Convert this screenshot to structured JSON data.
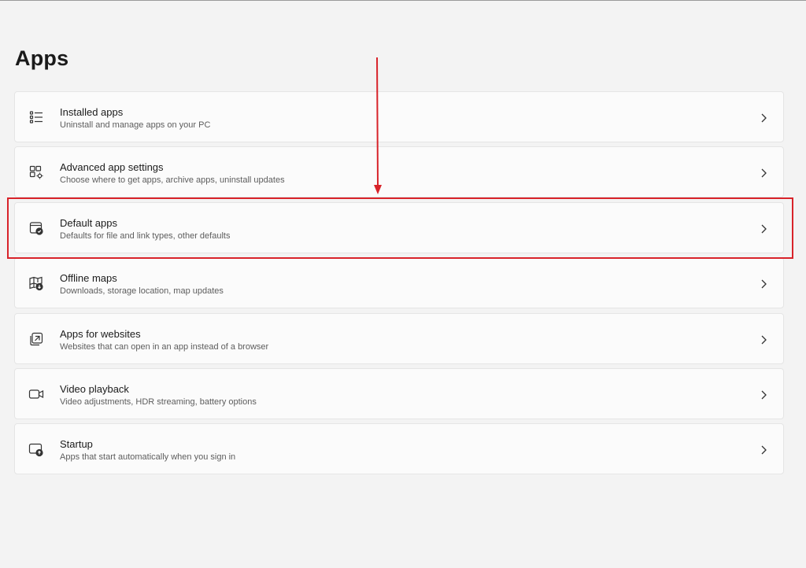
{
  "page": {
    "title": "Apps"
  },
  "items": [
    {
      "icon": "list-icon",
      "title": "Installed apps",
      "subtitle": "Uninstall and manage apps on your PC"
    },
    {
      "icon": "app-settings-icon",
      "title": "Advanced app settings",
      "subtitle": "Choose where to get apps, archive apps, uninstall updates"
    },
    {
      "icon": "default-apps-icon",
      "title": "Default apps",
      "subtitle": "Defaults for file and link types, other defaults"
    },
    {
      "icon": "offline-map-icon",
      "title": "Offline maps",
      "subtitle": "Downloads, storage location, map updates"
    },
    {
      "icon": "open-in-app-icon",
      "title": "Apps for websites",
      "subtitle": "Websites that can open in an app instead of a browser"
    },
    {
      "icon": "video-camera-icon",
      "title": "Video playback",
      "subtitle": "Video adjustments, HDR streaming, battery options"
    },
    {
      "icon": "startup-icon",
      "title": "Startup",
      "subtitle": "Apps that start automatically when you sign in"
    }
  ],
  "annotation": {
    "color": "#d8232a"
  },
  "colors": {
    "background": "#f3f3f3",
    "card": "#fbfbfb",
    "card_border": "#e5e5e5",
    "text_primary": "#1b1b1b",
    "text_secondary": "#5d5d5d"
  }
}
